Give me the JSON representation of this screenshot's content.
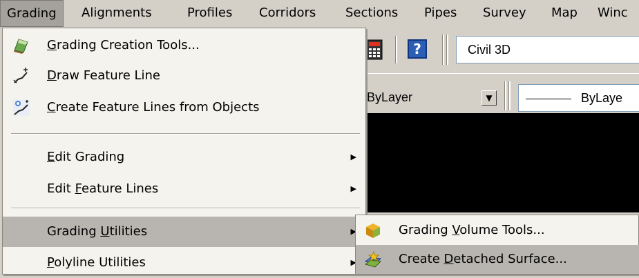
{
  "menubar": {
    "items": [
      "Grading",
      "Alignments",
      "Profiles",
      "Corridors",
      "Sections",
      "Pipes",
      "Survey",
      "Map",
      "Winc"
    ]
  },
  "toolbar": {
    "workspace_value": "Civil 3D",
    "layer_combo_value": "ByLayer",
    "linetype_combo_value": "ByLaye"
  },
  "grading_menu": {
    "items": [
      {
        "pre": "",
        "mn": "G",
        "post": "rading Creation Tools...",
        "icon": "grading-tools-icon"
      },
      {
        "pre": "",
        "mn": "D",
        "post": "raw Feature Line",
        "icon": "draw-feature-line-icon"
      },
      {
        "pre": "",
        "mn": "C",
        "post": "reate Feature Lines from Objects",
        "icon": "create-feature-lines-icon"
      },
      {
        "pre": "",
        "mn": "E",
        "post": "dit Grading",
        "submenu": true
      },
      {
        "pre": "Edit ",
        "mn": "F",
        "post": "eature Lines",
        "submenu": true
      },
      {
        "pre": "Grading ",
        "mn": "U",
        "post": "tilities",
        "submenu": true
      },
      {
        "pre": "",
        "mn": "P",
        "post": "olyline Utilities",
        "submenu": true
      }
    ]
  },
  "submenu": {
    "items": [
      {
        "pre": "Grading ",
        "mn": "V",
        "post": "olume Tools...",
        "icon": "volume-tools-icon"
      },
      {
        "pre": "Create ",
        "mn": "D",
        "post": "etached Surface...",
        "icon": "detached-surface-icon"
      }
    ]
  },
  "colors": {
    "menu_bg": "#f4f3ee",
    "highlight": "#b8b5b0",
    "chrome": "#d4d0c8"
  }
}
